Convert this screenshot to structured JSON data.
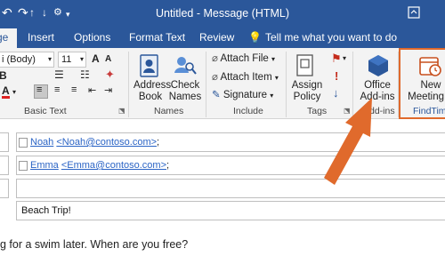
{
  "window": {
    "title": "Untitled - Message (HTML)"
  },
  "quick_access": {
    "icons": [
      "save-icon",
      "undo-icon",
      "redo-icon",
      "up-icon",
      "down-icon",
      "customize-icon"
    ]
  },
  "tabs": {
    "message": "ge",
    "insert": "Insert",
    "options": "Options",
    "format_text": "Format Text",
    "review": "Review",
    "tell_me": "Tell me what you want to do"
  },
  "ribbon": {
    "basic_text": {
      "font_name": "i (Body)",
      "font_size": "11",
      "label": "Basic Text"
    },
    "names": {
      "address_book": [
        "Address",
        "Book"
      ],
      "check_names": [
        "Check",
        "Names"
      ],
      "label": "Names"
    },
    "include": {
      "attach_file": "Attach File",
      "attach_item": "Attach Item",
      "signature": "Signature",
      "label": "Include"
    },
    "tags": {
      "assign_policy": [
        "Assign",
        "Policy"
      ],
      "label": "Tags"
    },
    "addins": {
      "office_addins": [
        "Office",
        "Add-ins"
      ],
      "label": "Add-ins"
    },
    "findtime": {
      "new_meeting": [
        "New",
        "Meeting P"
      ],
      "label": "FindTim"
    }
  },
  "form": {
    "to": {
      "name": "Noah",
      "address": "<Noah@contoso.com>",
      "sep": ";"
    },
    "cc": {
      "name": "Emma",
      "address": "<Emma@contoso.com>",
      "sep": ";"
    },
    "bcc": "",
    "subject": "Beach Trip!"
  },
  "body": {
    "text": "g for a swim later. When are you free?"
  },
  "colors": {
    "brand": "#2b579a",
    "highlight": "#e06a2c",
    "link": "#2b64c5"
  }
}
